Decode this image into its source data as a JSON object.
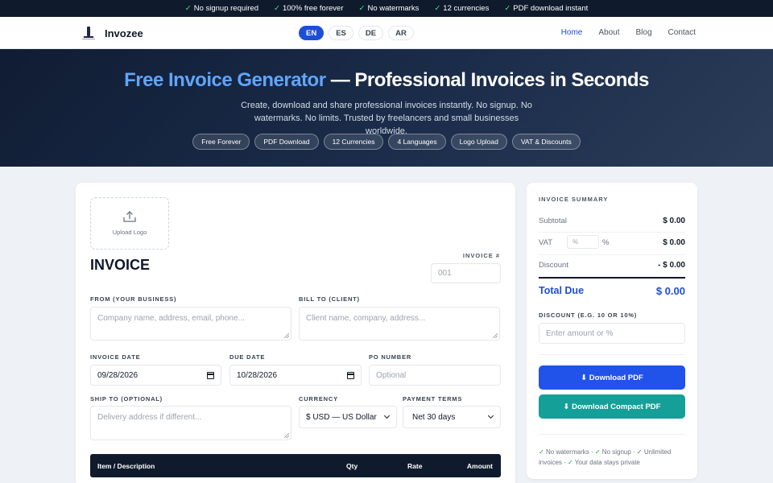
{
  "topbar": {
    "items": [
      "No signup required",
      "100% free forever",
      "No watermarks",
      "12 currencies",
      "PDF download instant"
    ]
  },
  "nav": {
    "brand": "Invozee",
    "languages": [
      "EN",
      "ES",
      "DE",
      "AR"
    ],
    "active_language": "EN",
    "links": [
      "Home",
      "About",
      "Blog",
      "Contact"
    ],
    "active_link": "Home"
  },
  "hero": {
    "title_highlight": "Free Invoice Generator",
    "title_rest": " — Professional Invoices in Seconds",
    "subtitle": "Create, download and share professional invoices instantly. No signup. No watermarks. No limits. Trusted by freelancers and small businesses worldwide.",
    "pills": [
      "Free Forever",
      "PDF Download",
      "12 Currencies",
      "4 Languages",
      "Logo Upload",
      "VAT & Discounts"
    ]
  },
  "invoice": {
    "upload_logo": "Upload Logo",
    "title": "INVOICE",
    "number_label": "INVOICE #",
    "number_placeholder": "001",
    "from_label": "FROM (YOUR BUSINESS)",
    "from_placeholder": "Company name, address, email, phone...",
    "bill_to_label": "BILL TO (CLIENT)",
    "bill_to_placeholder": "Client name, company, address...",
    "invoice_date_label": "INVOICE DATE",
    "invoice_date": "09/28/2026",
    "due_date_label": "DUE DATE",
    "due_date": "10/28/2026",
    "po_label": "PO NUMBER",
    "po_placeholder": "Optional",
    "ship_to_label": "SHIP TO (OPTIONAL)",
    "ship_to_placeholder": "Delivery address if different...",
    "currency_label": "CURRENCY",
    "currency_value": "$ USD — US Dollar",
    "terms_label": "PAYMENT TERMS",
    "terms_value": "Net 30 days",
    "table_headers": [
      "Item / Description",
      "Qty",
      "Rate",
      "Amount"
    ]
  },
  "summary": {
    "title": "INVOICE SUMMARY",
    "subtotal_label": "Subtotal",
    "subtotal": "$ 0.00",
    "vat_label": "VAT",
    "vat_placeholder": "%",
    "vat_pct": "%",
    "vat_value": "$ 0.00",
    "discount_label": "Discount",
    "discount_value": "- $ 0.00",
    "total_label": "Total Due",
    "total_value": "$ 0.00",
    "discount_input_label": "DISCOUNT (E.G. 10 OR 10%)",
    "discount_input_placeholder": "Enter amount or %",
    "download_pdf": "⬇ Download PDF",
    "download_compact": "⬇ Download Compact PDF",
    "trust_1": "No watermarks",
    "trust_2": "No signup",
    "trust_3": "Unlimited invoices",
    "trust_4": "Your data stays private"
  },
  "colors": {
    "accent": "#1d4ed8",
    "hero_bg": "#101c33",
    "teal": "#14a098",
    "check": "#4ade80"
  }
}
